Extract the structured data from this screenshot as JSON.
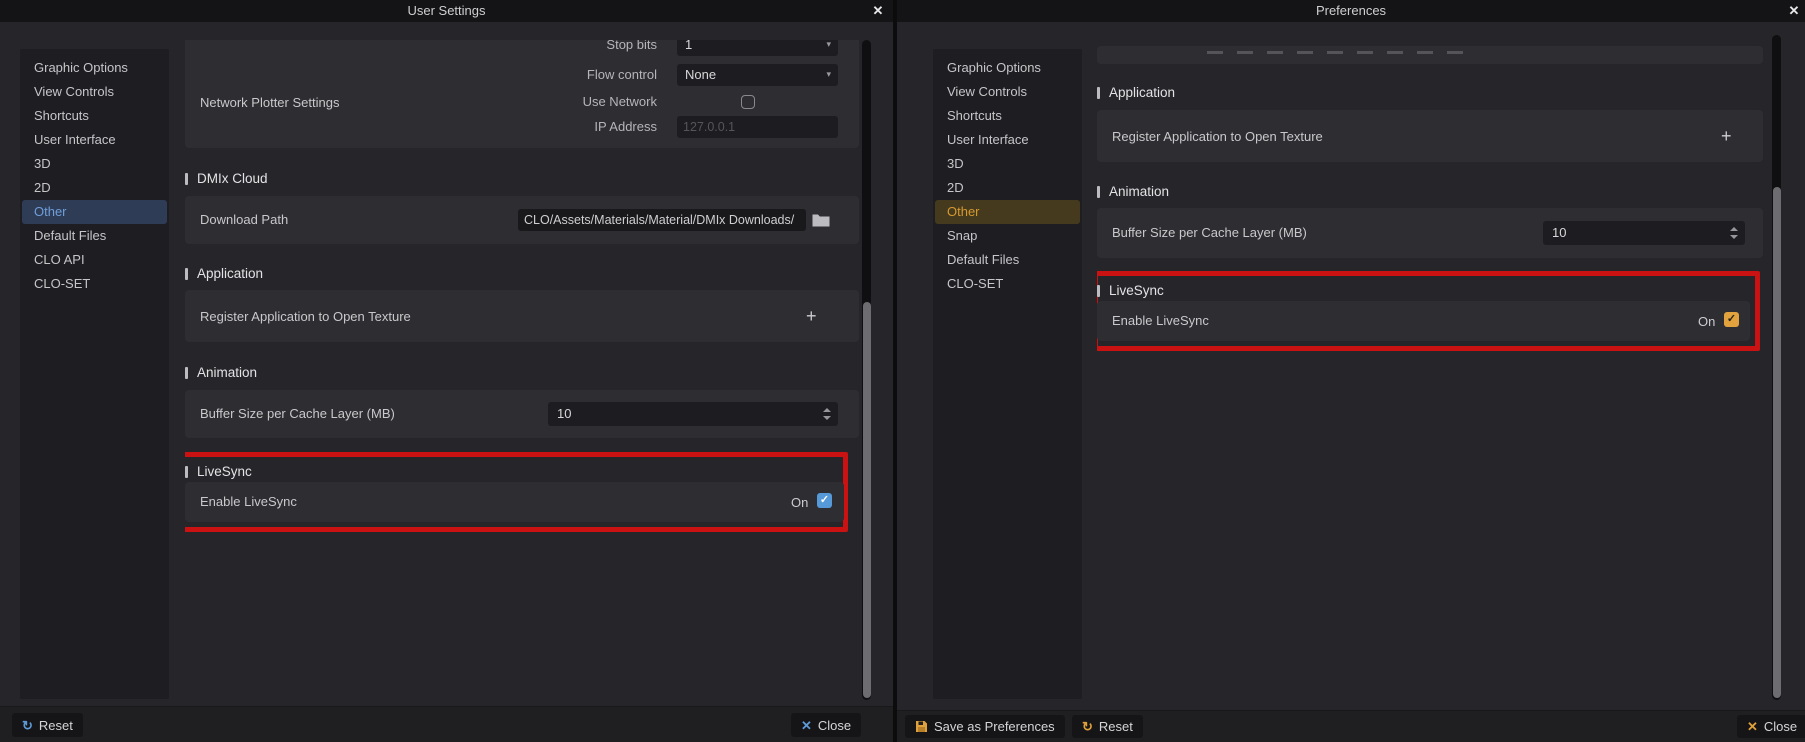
{
  "icons": {
    "close": "✕",
    "check": "✓",
    "arrow_down": "▾",
    "plus": "+",
    "reset": "↻"
  },
  "left": {
    "title": "User Settings",
    "sidebar": {
      "items": [
        "Graphic Options",
        "View Controls",
        "Shortcuts",
        "User Interface",
        "3D",
        "2D",
        "Other",
        "Default Files",
        "CLO API",
        "CLO-SET"
      ],
      "selected": "Other"
    },
    "sections": {
      "dmix": "DMIx Cloud",
      "application": "Application",
      "animation": "Animation",
      "livesync": "LiveSync"
    },
    "network": {
      "label": "Network Plotter Settings",
      "stop_bits": {
        "label": "Stop bits",
        "value": "1"
      },
      "flow_control": {
        "label": "Flow control",
        "value": "None"
      },
      "use_network": {
        "label": "Use Network",
        "checked": false
      },
      "ip": {
        "label": "IP Address",
        "value": "127.0.0.1",
        "disabled": true
      }
    },
    "download": {
      "label": "Download Path",
      "value": "CLO/Assets/Materials/Material/DMIx Downloads/"
    },
    "register": {
      "label": "Register Application to Open Texture"
    },
    "buffer": {
      "label": "Buffer Size per Cache Layer (MB)",
      "value": "10"
    },
    "enable": {
      "label": "Enable LiveSync",
      "state": "On",
      "checked": true
    },
    "footer": {
      "reset": "Reset",
      "close": "Close"
    },
    "accent": "#5e9ad8"
  },
  "right": {
    "title": "Preferences",
    "sidebar": {
      "items": [
        "Graphic Options",
        "View Controls",
        "Shortcuts",
        "User Interface",
        "3D",
        "2D",
        "Other",
        "Snap",
        "Default Files",
        "CLO-SET"
      ],
      "selected": "Other"
    },
    "sections": {
      "application": "Application",
      "animation": "Animation",
      "livesync": "LiveSync"
    },
    "register": {
      "label": "Register Application to Open Texture"
    },
    "buffer": {
      "label": "Buffer Size per Cache Layer (MB)",
      "value": "10"
    },
    "enable": {
      "label": "Enable LiveSync",
      "state": "On",
      "checked": true
    },
    "footer": {
      "save": "Save as Preferences",
      "reset": "Reset",
      "close": "Close"
    },
    "accent": "#e0a03c"
  },
  "colors": {
    "highlight_box": "#cb1212",
    "left_accent": "#5e9ad8",
    "right_accent": "#e0a03c",
    "selected_left_bg": "#2e3c55",
    "selected_right_bg": "#453a1e"
  }
}
